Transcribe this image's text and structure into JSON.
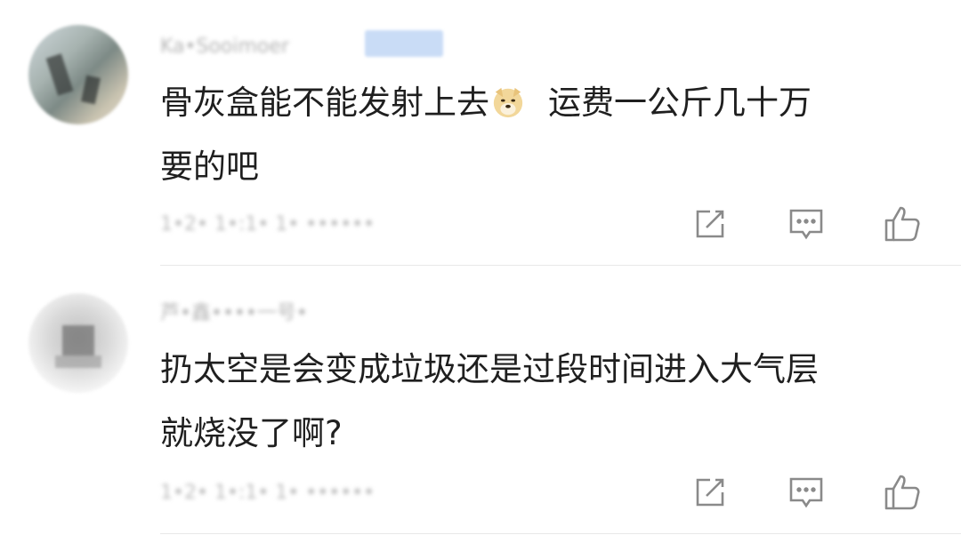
{
  "comments": [
    {
      "username": "Ka•Sooimoer",
      "text_line1": "骨灰盒能不能发射上去",
      "emoji": "doge-emoji",
      "text_line1_tail": "运费一公斤几十万",
      "text_line2": "要的吧",
      "meta": "1•2• 1•:1• 1• ••••••",
      "actions": [
        "share-icon",
        "reply-icon",
        "like-icon"
      ]
    },
    {
      "username": "芦•鑫••••一号•",
      "text_line1": "扔太空是会变成垃圾还是过段时间进入大气层",
      "text_line2": "就烧没了啊?",
      "meta": "1•2• 1•:1• 1• ••••••",
      "actions": [
        "share-icon",
        "reply-icon",
        "like-icon"
      ]
    }
  ],
  "colors": {
    "text": "#1f1f1f",
    "icon": "#8a8a8a",
    "divider": "#e8e8e8",
    "badge": "#c9dcf6"
  }
}
